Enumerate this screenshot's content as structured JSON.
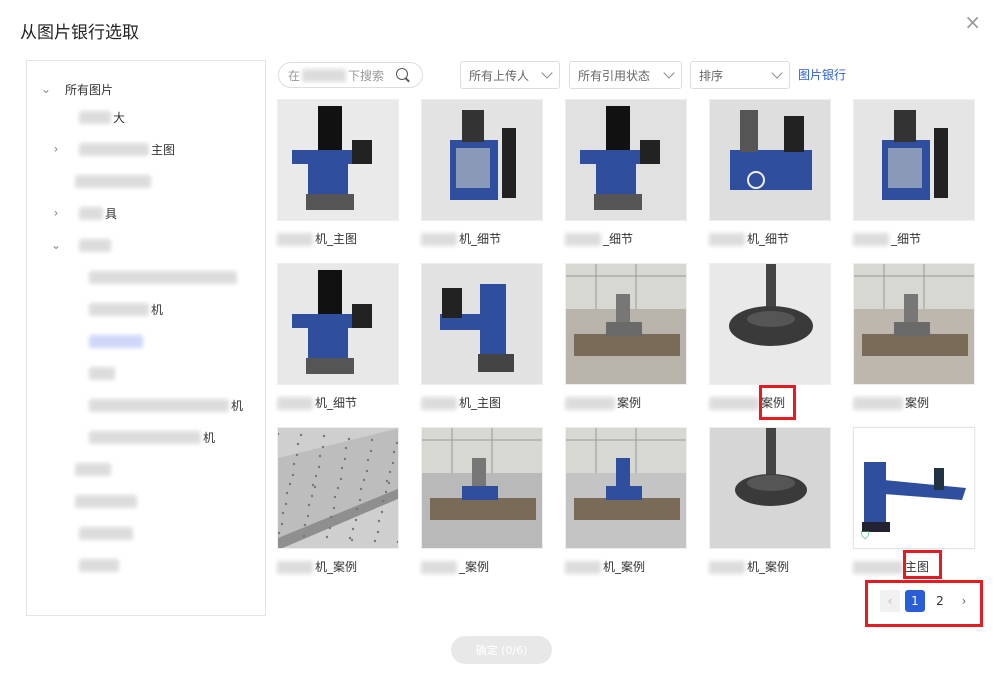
{
  "dialog": {
    "title": "从图片银行选取",
    "close_label": "×"
  },
  "tree": {
    "root_label": "所有图片",
    "items": [
      {
        "label": "大",
        "hidden_width": 32,
        "chev": "",
        "indent": 52
      },
      {
        "label": "主图",
        "hidden_width": 70,
        "chev": "›",
        "indent": 52
      },
      {
        "label": "",
        "hidden_width": 76,
        "chev": "",
        "indent": 48
      },
      {
        "label": "具",
        "hidden_width": 24,
        "chev": "›",
        "indent": 52
      },
      {
        "label": "",
        "hidden_width": 32,
        "chev": "⌄",
        "indent": 52
      },
      {
        "label": "",
        "hidden_width": 148,
        "chev": "",
        "indent": 62
      },
      {
        "label": "机",
        "hidden_width": 60,
        "chev": "",
        "indent": 62
      },
      {
        "label": "",
        "hidden_width": 54,
        "chev": "",
        "indent": 62,
        "blue": true
      },
      {
        "label": "",
        "hidden_width": 26,
        "chev": "",
        "indent": 62
      },
      {
        "label": "机",
        "hidden_width": 140,
        "chev": "",
        "indent": 62
      },
      {
        "label": "机",
        "hidden_width": 112,
        "chev": "",
        "indent": 62
      },
      {
        "label": "",
        "hidden_width": 36,
        "chev": "",
        "indent": 48
      },
      {
        "label": "",
        "hidden_width": 62,
        "chev": "",
        "indent": 48
      },
      {
        "label": "",
        "hidden_width": 54,
        "chev": "",
        "indent": 52
      },
      {
        "label": "",
        "hidden_width": 40,
        "chev": "",
        "indent": 52
      }
    ]
  },
  "toolbar": {
    "search_prefix": "在",
    "search_suffix": "下搜索",
    "uploader": "所有上传人",
    "ref_status": "所有引用状态",
    "sort": "排序",
    "bank_link": "图片银行"
  },
  "images": [
    {
      "label": "机_主图",
      "scene": "machine",
      "bg": "#eaeaea"
    },
    {
      "label": "机_细节",
      "scene": "cabinet",
      "bg": "#e3e3e3"
    },
    {
      "label": "_细节",
      "scene": "machine",
      "bg": "#e1e1e1"
    },
    {
      "label": "机_细节",
      "scene": "frame",
      "bg": "#dedede"
    },
    {
      "label": "_细节",
      "scene": "cabinet",
      "bg": "#e5e5e5"
    },
    {
      "label": "机_细节",
      "scene": "machine",
      "bg": "#e8e8e8"
    },
    {
      "label": "机_主图",
      "scene": "arm",
      "bg": "#e2e2e2"
    },
    {
      "label": "案例",
      "scene": "workshop",
      "bg": "#b8b4ac"
    },
    {
      "label": "案例",
      "scene": "disc",
      "bg": "#e9e9e9"
    },
    {
      "label": "案例",
      "scene": "workshop",
      "bg": "#bdb7ad"
    },
    {
      "label": "机_案例",
      "scene": "granite",
      "bg": "#cfcfcf"
    },
    {
      "label": "_案例",
      "scene": "site",
      "bg": "#b9b9b9"
    },
    {
      "label": "机_案例",
      "scene": "site2",
      "bg": "#c4c4c4"
    },
    {
      "label": "机_案例",
      "scene": "disc2",
      "bg": "#d6d6d6"
    },
    {
      "label": "主图",
      "scene": "product",
      "bg": "#ffffff"
    }
  ],
  "pagination": {
    "prev": "‹",
    "pages": [
      "1",
      "2"
    ],
    "current": "1",
    "next": "›"
  },
  "confirm_label": "确定 (0/6)",
  "colors": {
    "accent": "#2b5ed6",
    "highlight": "#e31b23",
    "machine_blue": "#2f4f9e"
  }
}
